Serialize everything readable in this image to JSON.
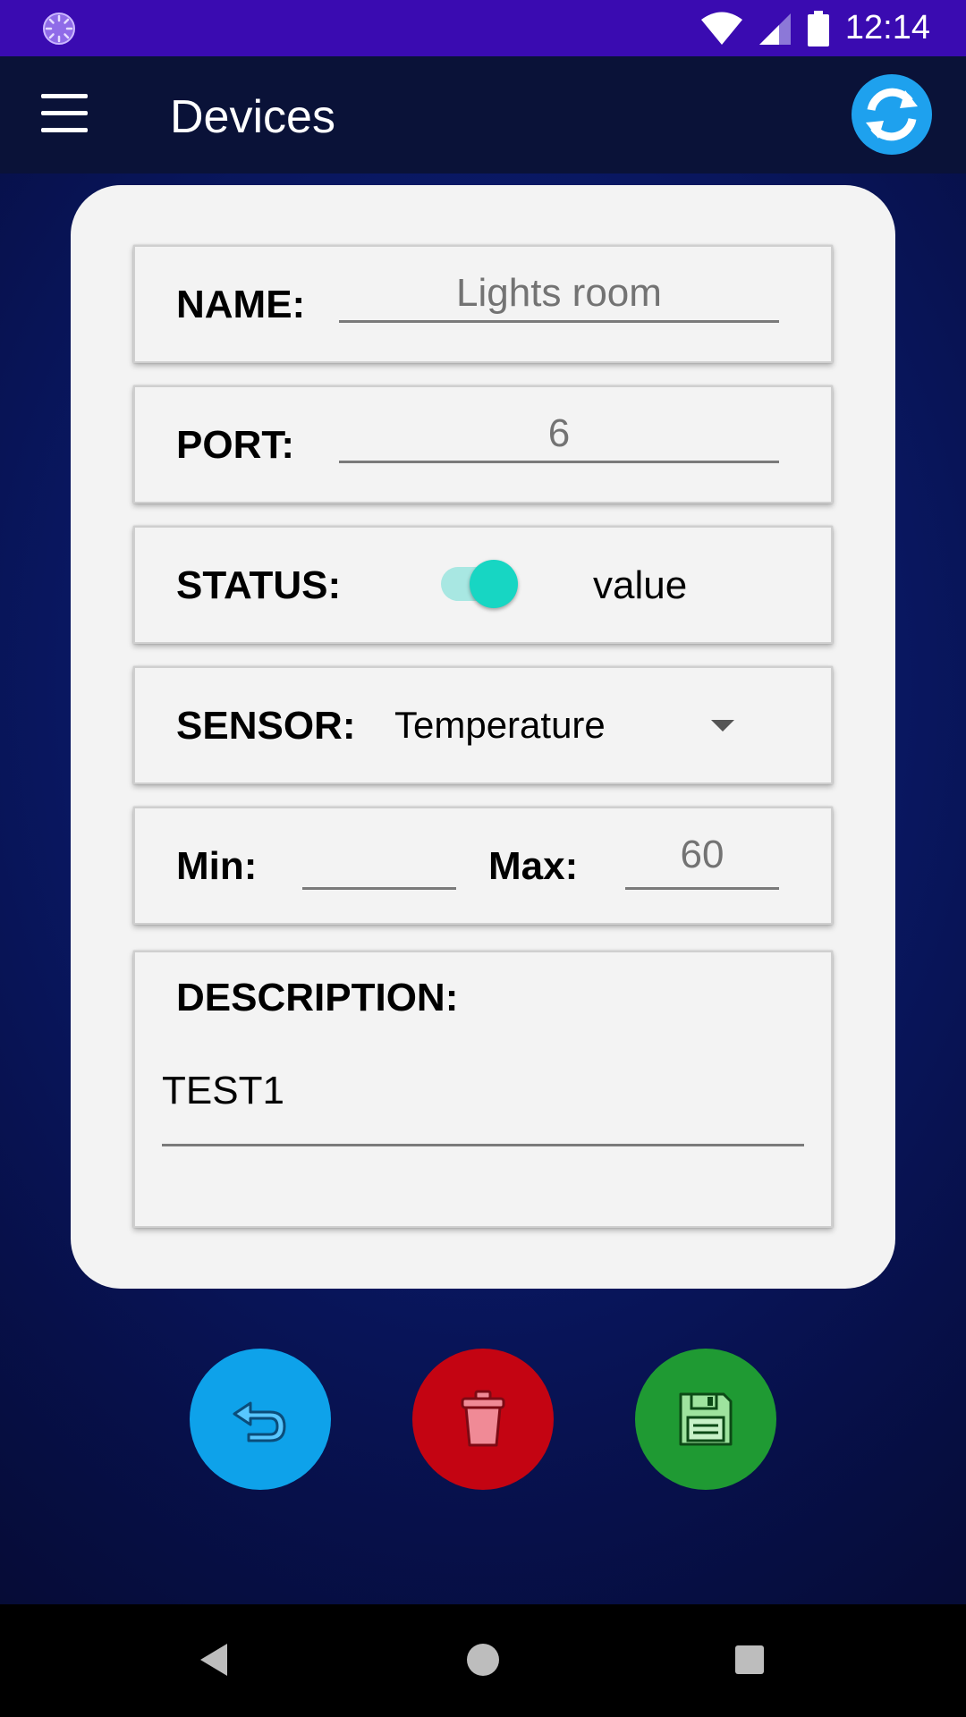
{
  "status_bar": {
    "time": "12:14",
    "icons": [
      "spinner-icon",
      "wifi-icon",
      "signal-icon",
      "battery-icon"
    ],
    "background": "#3a0bb1"
  },
  "app_bar": {
    "title": "Devices",
    "menu_icon": "hamburger-menu-icon",
    "refresh_icon": "refresh-icon",
    "refresh_color": "#1ea1ee"
  },
  "form": {
    "name": {
      "label": "NAME:",
      "value": "Lights room"
    },
    "port": {
      "label": "PORT:",
      "value": "6"
    },
    "status": {
      "label": "STATUS:",
      "toggle_on": true,
      "value_text": "value",
      "toggle_color": "#17d6c3"
    },
    "sensor": {
      "label": "SENSOR:",
      "selected": "Temperature"
    },
    "min": {
      "label": "Min:",
      "value": ""
    },
    "max": {
      "label": "Max:",
      "value": "60"
    },
    "description": {
      "label": "DESCRIPTION:",
      "value": "TEST1"
    }
  },
  "actions": [
    {
      "name": "back",
      "icon": "undo-icon",
      "color": "#0ea2ea"
    },
    {
      "name": "delete",
      "icon": "trash-icon",
      "color": "#c40412"
    },
    {
      "name": "save",
      "icon": "floppy-disk-icon",
      "color": "#1f9a33"
    }
  ],
  "nav_bar": {
    "icons": [
      "back-triangle-icon",
      "home-circle-icon",
      "recents-square-icon"
    ]
  }
}
